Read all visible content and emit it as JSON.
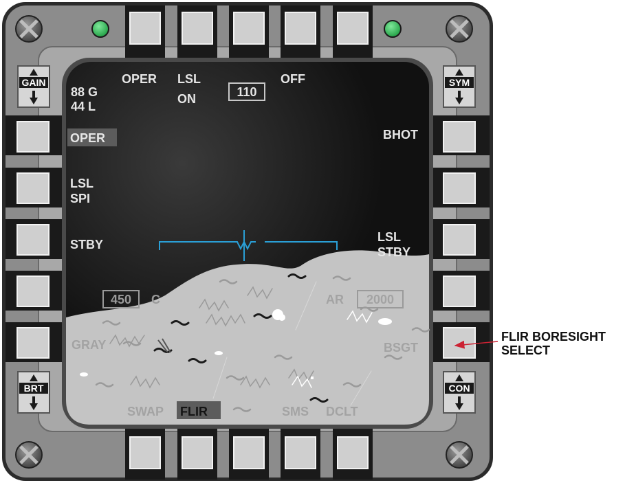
{
  "colors": {
    "bezel": "#8a8a8a",
    "bezel_inner": "#b3b3b3",
    "frame": "#1a1a1a",
    "button_face": "#c8c8c8",
    "indicator": "#22b24c",
    "screen_dark": "#141414",
    "terrain": "#c6c6c6",
    "legend_text": "#e6e6e6",
    "dim_text": "#a0a0a0",
    "symbology": "#2a9fd6",
    "callout_arrow": "#cc2233"
  },
  "rockers": {
    "gain": "GAIN",
    "sym": "SYM",
    "brt": "BRT",
    "con": "CON"
  },
  "display": {
    "top": {
      "oper": "OPER",
      "lsl": "LSL",
      "lsl_state": "ON",
      "heading": "110",
      "off": "OFF"
    },
    "codes": {
      "line1": "88 G",
      "line2": "44 L"
    },
    "left": {
      "oper": "OPER",
      "lsl": "LSL",
      "spi": "SPI",
      "stby": "STBY",
      "gray": "GRAY"
    },
    "right": {
      "bhot": "BHOT",
      "lsl": "LSL",
      "stby": "STBY",
      "bsgt": "BSGT"
    },
    "speed_box": "450",
    "speed_unit": "C",
    "ar": "AR",
    "alt_box": "2000",
    "bottom": {
      "swap": "SWAP",
      "flir": "FLIR",
      "sms": "SMS",
      "dclt": "DCLT"
    }
  },
  "callout": {
    "line1": "FLIR BORESIGHT",
    "line2": "SELECT"
  }
}
